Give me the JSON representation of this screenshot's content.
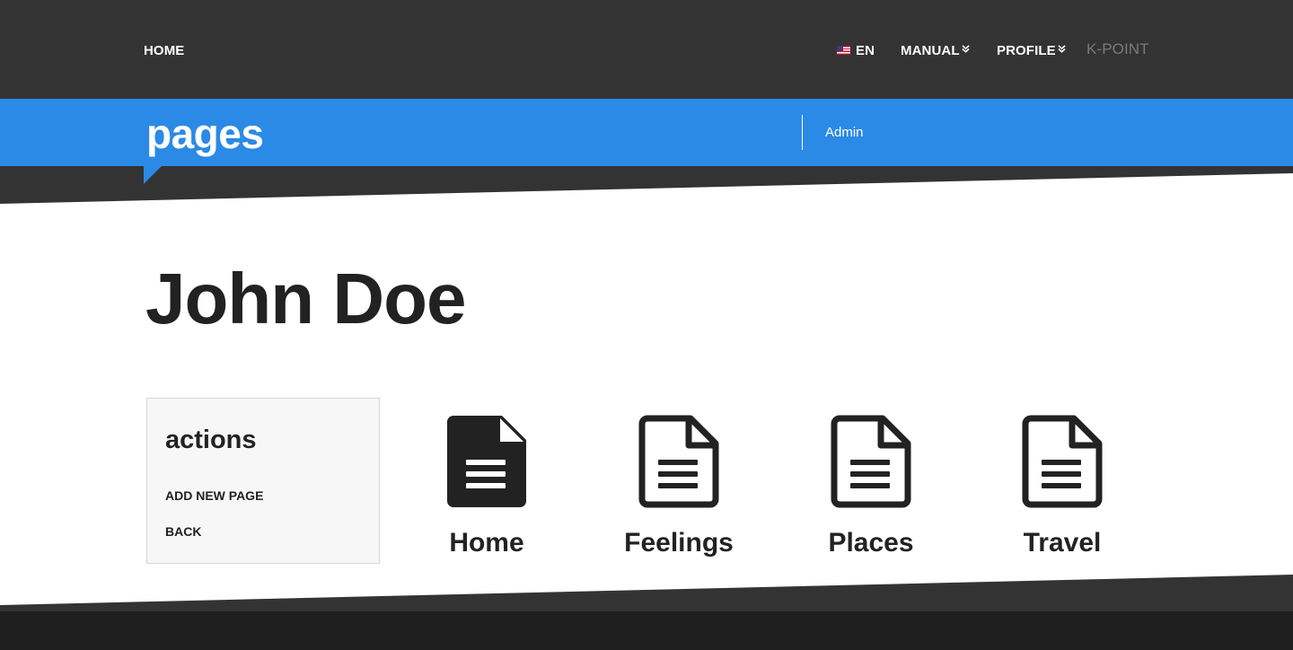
{
  "nav": {
    "home": "HOME",
    "language": "EN",
    "manual": "MANUAL",
    "profile": "PROFILE",
    "brand": "K-POINT",
    "dropdown_glyph": "»"
  },
  "titlebar": {
    "heading": "pages",
    "admin": "Admin"
  },
  "main": {
    "person_name": "John Doe",
    "actions": {
      "title": "actions",
      "add_new_page": "ADD NEW PAGE",
      "back": "BACK"
    },
    "pages": [
      {
        "label": "Home",
        "icon": "document-filled-icon"
      },
      {
        "label": "Feelings",
        "icon": "document-outline-icon"
      },
      {
        "label": "Places",
        "icon": "document-outline-icon"
      },
      {
        "label": "Travel",
        "icon": "document-outline-icon"
      }
    ]
  },
  "colors": {
    "nav_bg": "#333333",
    "accent_blue": "#2b8ae6",
    "text_dark": "#222222",
    "panel_bg": "#f7f7f7",
    "brand_muted": "#7a7a7a",
    "footer_bg": "#1f1f1f"
  }
}
